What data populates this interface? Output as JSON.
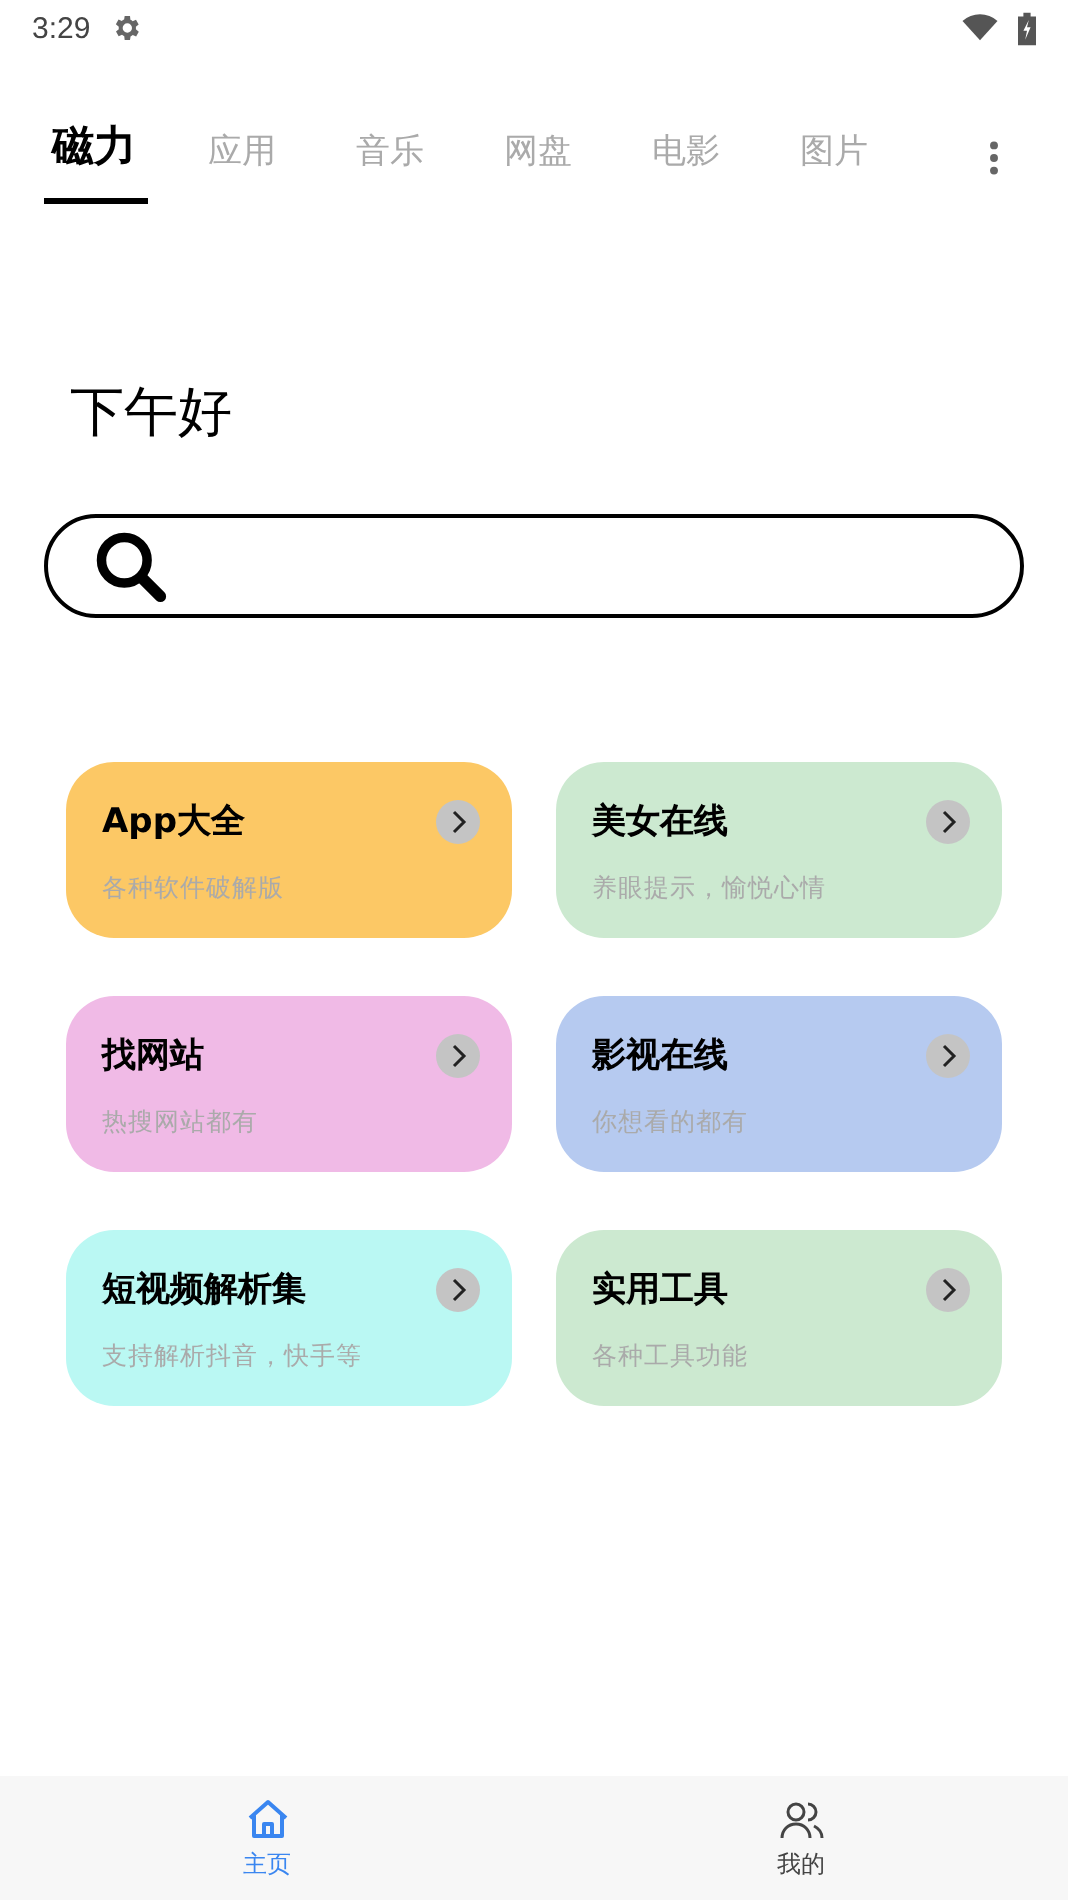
{
  "status_bar": {
    "time": "3:29"
  },
  "tabs": [
    {
      "label": "磁力",
      "selected": true
    },
    {
      "label": "应用",
      "selected": false
    },
    {
      "label": "音乐",
      "selected": false
    },
    {
      "label": "网盘",
      "selected": false
    },
    {
      "label": "电影",
      "selected": false
    },
    {
      "label": "图片",
      "selected": false
    }
  ],
  "greeting": "下午好",
  "cards": [
    {
      "title": "App大全",
      "subtitle": "各种软件破解版",
      "color": "#fcc865"
    },
    {
      "title": "美女在线",
      "subtitle": "养眼提示，愉悦心情",
      "color": "#cce9d0"
    },
    {
      "title": "找网站",
      "subtitle": "热搜网站都有",
      "color": "#f0bae6"
    },
    {
      "title": "影视在线",
      "subtitle": "你想看的都有",
      "color": "#b6caf0"
    },
    {
      "title": "短视频解析集",
      "subtitle": "支持解析抖音，快手等",
      "color": "#baf8f3"
    },
    {
      "title": "实用工具",
      "subtitle": "各种工具功能",
      "color": "#cce9d0"
    }
  ],
  "bottom_nav": [
    {
      "label": "主页",
      "kind": "home",
      "selected": true
    },
    {
      "label": "我的",
      "kind": "profile",
      "selected": false
    }
  ]
}
